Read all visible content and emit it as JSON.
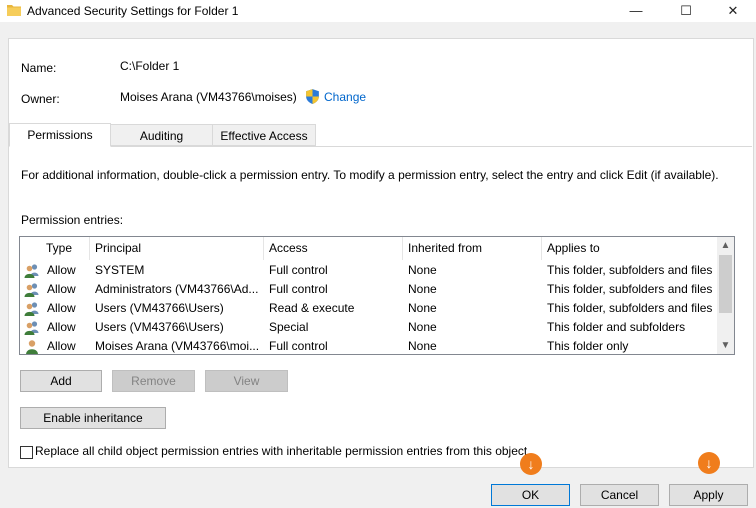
{
  "window": {
    "title": "Advanced Security Settings for Folder 1",
    "minimize_glyph": "—",
    "maximize_glyph": "☐",
    "close_glyph": "✕"
  },
  "details": {
    "name_label": "Name:",
    "name_value": "C:\\Folder 1",
    "owner_label": "Owner:",
    "owner_value": "Moises Arana (VM43766\\moises)",
    "change_label": "Change"
  },
  "tabs": [
    {
      "label": "Permissions",
      "active": true
    },
    {
      "label": "Auditing",
      "active": false
    },
    {
      "label": "Effective Access",
      "active": false
    }
  ],
  "info_text": "For additional information, double-click a permission entry. To modify a permission entry, select the entry and click Edit (if available).",
  "entries_label": "Permission entries:",
  "table": {
    "columns": [
      "Type",
      "Principal",
      "Access",
      "Inherited from",
      "Applies to"
    ],
    "rows": [
      {
        "type": "Allow",
        "principal": "SYSTEM",
        "access": "Full control",
        "inherited": "None",
        "applies": "This folder, subfolders and files",
        "icon": "group-users-icon"
      },
      {
        "type": "Allow",
        "principal": "Administrators (VM43766\\Ad...",
        "access": "Full control",
        "inherited": "None",
        "applies": "This folder, subfolders and files",
        "icon": "group-users-icon"
      },
      {
        "type": "Allow",
        "principal": "Users (VM43766\\Users)",
        "access": "Read & execute",
        "inherited": "None",
        "applies": "This folder, subfolders and files",
        "icon": "group-users-icon"
      },
      {
        "type": "Allow",
        "principal": "Users (VM43766\\Users)",
        "access": "Special",
        "inherited": "None",
        "applies": "This folder and subfolders",
        "icon": "group-users-icon"
      },
      {
        "type": "Allow",
        "principal": "Moises Arana (VM43766\\moi...",
        "access": "Full control",
        "inherited": "None",
        "applies": "This folder only",
        "icon": "single-user-icon"
      }
    ]
  },
  "scroll": {
    "up_glyph": "▲",
    "down_glyph": "▼"
  },
  "buttons": {
    "add": "Add",
    "remove": "Remove",
    "view": "View",
    "enable_inheritance": "Enable inheritance",
    "ok": "OK",
    "cancel": "Cancel",
    "apply": "Apply"
  },
  "replace_checkbox": {
    "label": "Replace all child object permission entries with inheritable permission entries from this object",
    "checked": false
  },
  "badge_glyph": "↓",
  "colors": {
    "accent": "#0078d7",
    "link": "#0066cc",
    "badge": "#f07d1c"
  }
}
